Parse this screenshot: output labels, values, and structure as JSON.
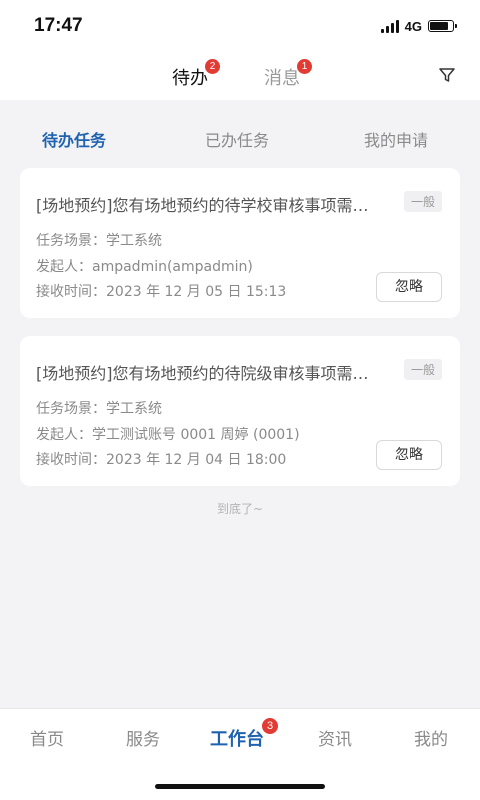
{
  "status_bar": {
    "time": "17:47",
    "network": "4G",
    "battery_level": 0.8
  },
  "header": {
    "tabs": [
      {
        "label": "待办",
        "badge": "2",
        "active": true
      },
      {
        "label": "消息",
        "badge": "1",
        "active": false
      }
    ],
    "filter_icon": "filter-icon"
  },
  "subtabs": [
    {
      "label": "待办任务",
      "active": true
    },
    {
      "label": "已办任务",
      "active": false
    },
    {
      "label": "我的申请",
      "active": false
    }
  ],
  "tasks": [
    {
      "title": "[场地预约]您有场地预约的待学校审核事项需要处理",
      "tag": "一般",
      "scene": "任务场景：学工系统",
      "initiator": "发起人：ampadmin(ampadmin)",
      "received": "接收时间：2023 年 12 月 05 日 15:13",
      "action_label": "忽略"
    },
    {
      "title": "[场地预约]您有场地预约的待院级审核事项需要处理",
      "tag": "一般",
      "scene": "任务场景：学工系统",
      "initiator": "发起人：学工测试账号 0001 周婷 (0001)",
      "received": "接收时间：2023 年 12 月 04 日 18:00",
      "action_label": "忽略"
    }
  ],
  "list_end_text": "到底了~",
  "bottom_nav": [
    {
      "label": "首页",
      "badge": ""
    },
    {
      "label": "服务",
      "badge": ""
    },
    {
      "label": "工作台",
      "badge": "3",
      "active": true
    },
    {
      "label": "资讯",
      "badge": ""
    },
    {
      "label": "我的",
      "badge": ""
    }
  ],
  "colors": {
    "accent": "#1f63b0",
    "badge": "#e23b34",
    "background": "#f3f3f5"
  }
}
